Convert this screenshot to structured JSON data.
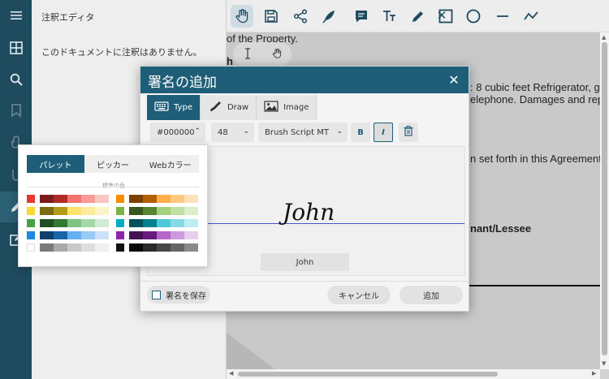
{
  "app": {
    "panel_title": "注釈エディタ",
    "empty_message": "このドキュメントに注釈はありません。"
  },
  "document": {
    "lines": [
      "of the Property.",
      "h",
      ": 8 cubic feet Refrigerator, ga",
      "elephone. Damages and repa",
      "n set forth in this Agreement.",
      "nant/Lessee"
    ]
  },
  "signature_dialog": {
    "title": "署名の追加",
    "tabs": [
      "Type",
      "Draw",
      "Image"
    ],
    "color_value": "#000000",
    "font_size": "48",
    "font_name": "Brush Script MT",
    "bold_label": "B",
    "italic_label": "I",
    "signature_text": "John",
    "name_value": "John",
    "save_label": "署名を保存",
    "cancel_label": "キャンセル",
    "add_label": "追加"
  },
  "color_picker": {
    "tabs": [
      "パレット",
      "ピッカー",
      "Webカラー"
    ],
    "standard_label": "標準の色",
    "left_rows": [
      [
        "#e53935",
        "#7b1c1c",
        "#b02a2a",
        "#f4736b",
        "#f79b96",
        "#f9c6c3"
      ],
      [
        "#fdd835",
        "#7a6a12",
        "#b39b1a",
        "#fbe36e",
        "#fcec9c",
        "#fdf5c8"
      ],
      [
        "#43a047",
        "#1f4f22",
        "#2f7a33",
        "#7cc47f",
        "#a6d8a8",
        "#d0ecd1"
      ],
      [
        "#1e88e5",
        "#0f3f6b",
        "#1764aa",
        "#64b0f0",
        "#99caf5",
        "#c9e2fa"
      ],
      [
        "#ffffff",
        "#7a7a7a",
        "#a9a9a9",
        "#c9c9c9",
        "#dedede",
        "#f0f0f0"
      ]
    ],
    "right_rows": [
      [
        "#fb8c00",
        "#7a4100",
        "#b35f00",
        "#fcae4d",
        "#fdc882",
        "#fee1b8"
      ],
      [
        "#7cb342",
        "#3a5620",
        "#588431",
        "#a5cf7a",
        "#c1dea3",
        "#dcedcb"
      ],
      [
        "#00acc1",
        "#00535e",
        "#00808f",
        "#4dc8d6",
        "#86dae3",
        "#bfecf1"
      ],
      [
        "#8e24aa",
        "#441155",
        "#691a7f",
        "#b467ca",
        "#cd9bdb",
        "#e5cdec"
      ],
      [
        "#111111",
        "#0a0a0a",
        "#2b2b2b",
        "#474747",
        "#666666",
        "#8a8a8a"
      ]
    ]
  },
  "icons": {
    "rail": [
      "menu-icon",
      "grid-icon",
      "search-icon",
      "bookmark-icon",
      "attachment-icon",
      "clip-icon",
      "pen-icon",
      "edit-box-icon"
    ],
    "toolbar": [
      "close-icon",
      "hand-icon",
      "save-icon",
      "share-icon",
      "feather-pen-icon",
      "comment-icon",
      "text-size-icon",
      "pen-icon",
      "rectangle-icon",
      "circle-icon",
      "line-icon",
      "polyline-icon"
    ]
  }
}
